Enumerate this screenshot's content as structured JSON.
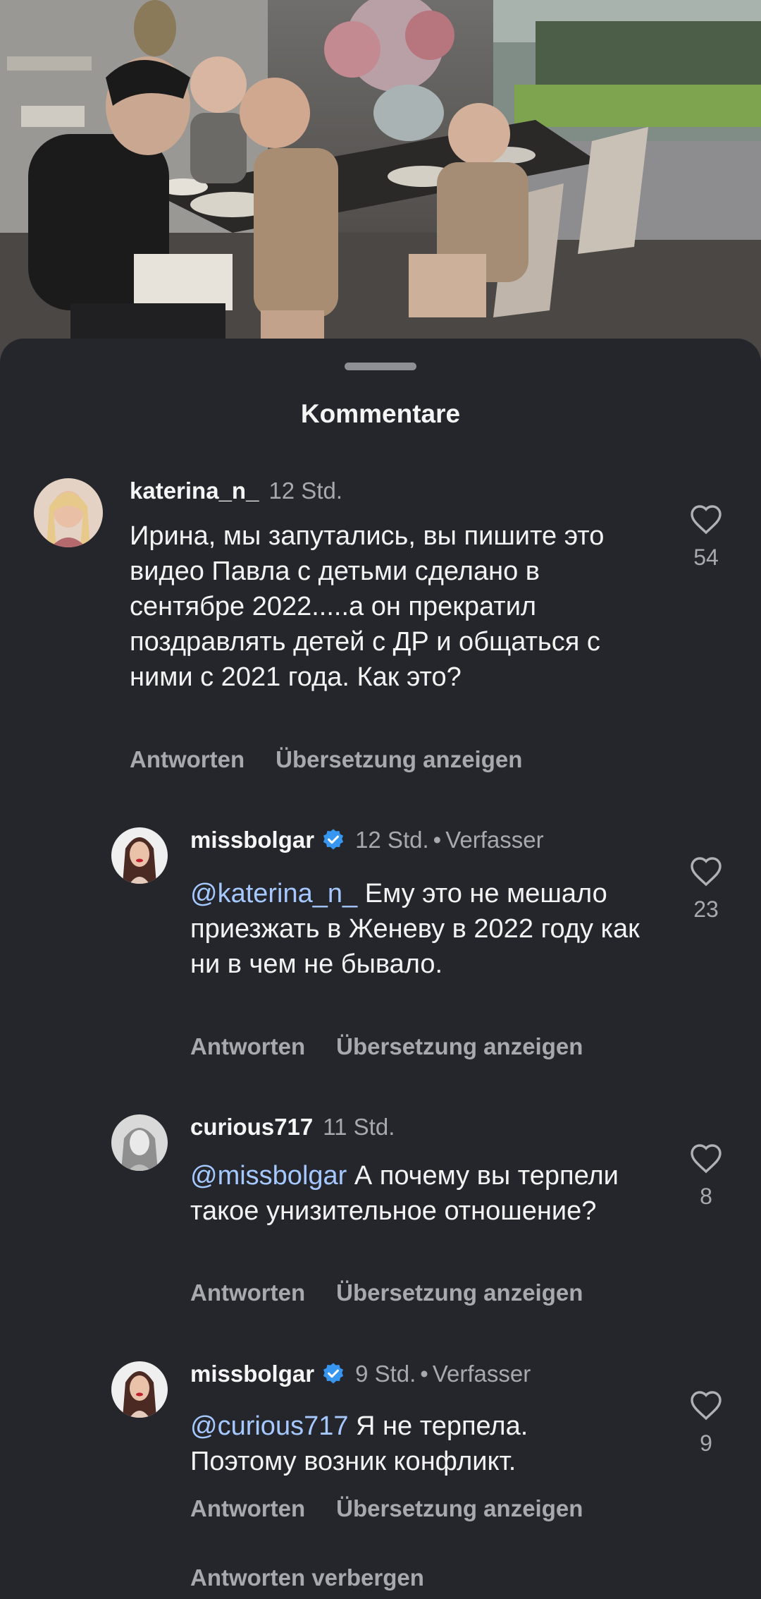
{
  "sheet": {
    "title": "Kommentare"
  },
  "comments": [
    {
      "username": "katerina_n_",
      "time": "12 Std.",
      "text": "Ирина, мы запутались, вы пишите это видео Павла с детьми сделано в сентябре 2022.....а он прекратил поздравлять детей с ДР и общаться с ними с 2021 года. Как это?",
      "reply_label": "Antworten",
      "translate_label": "Übersetzung anzeigen",
      "likes": "54"
    },
    {
      "username": "missbolgar",
      "verified": true,
      "time": "12 Std.",
      "separator": "•",
      "author_label": "Verfasser",
      "mention": "@katerina_n_",
      "text": " Ему это не мешало приезжать в Женеву в 2022 году как ни в чем не бывало.",
      "reply_label": "Antworten",
      "translate_label": "Übersetzung anzeigen",
      "likes": "23"
    },
    {
      "username": "curious717",
      "time": "11 Std.",
      "mention": "@missbolgar",
      "text": " А почему вы терпели такое унизительное отношение?",
      "reply_label": "Antworten",
      "translate_label": "Übersetzung anzeigen",
      "likes": "8"
    },
    {
      "username": "missbolgar",
      "verified": true,
      "time": "9 Std.",
      "separator": "•",
      "author_label": "Verfasser",
      "mention": "@curious717",
      "text": " Я не терпела. Поэтому возник конфликт.",
      "reply_label": "Antworten",
      "translate_label": "Übersetzung anzeigen",
      "likes": "9"
    }
  ],
  "hide_replies_label": "Antworten verbergen",
  "colors": {
    "sheet": "#25262b",
    "mention": "#a5c8ff",
    "verified": "#3797f0",
    "muted": "#a8a9ae"
  }
}
